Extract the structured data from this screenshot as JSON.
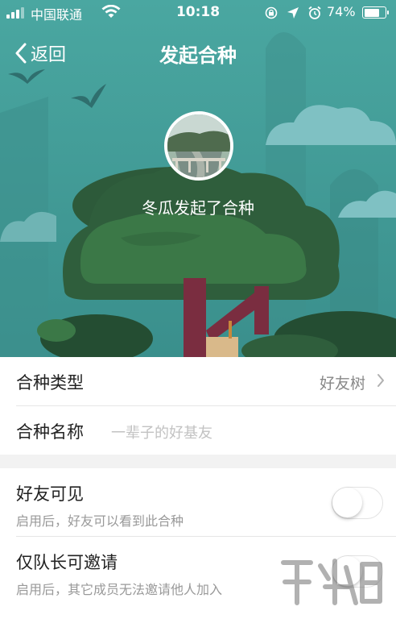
{
  "status_bar": {
    "carrier": "中国联通",
    "time": "10:18",
    "battery": "74%",
    "battery_level": 0.74
  },
  "nav": {
    "back_label": "返回",
    "title": "发起合种"
  },
  "hero": {
    "starter_text": "冬瓜发起了合种"
  },
  "rows": {
    "type_label": "合种类型",
    "type_value": "好友树",
    "name_label": "合种名称",
    "name_placeholder": "一辈子的好基友"
  },
  "toggles": [
    {
      "label": "好友可见",
      "sub": "启用后，好友可以看到此合种",
      "on": false
    },
    {
      "label": "仅队长可邀请",
      "sub": "启用后，其它成员无法邀请他人加入",
      "on": false
    }
  ],
  "colors": {
    "hero_bg": "#3e9e98",
    "tree_dark": "#2f5e3c",
    "tree_mid": "#3b7847",
    "trunk": "#7a2d40",
    "cloud": "#7fc1c3"
  },
  "icons": {
    "back": "chevron-left-icon",
    "row_arrow": "chevron-right-icon"
  }
}
